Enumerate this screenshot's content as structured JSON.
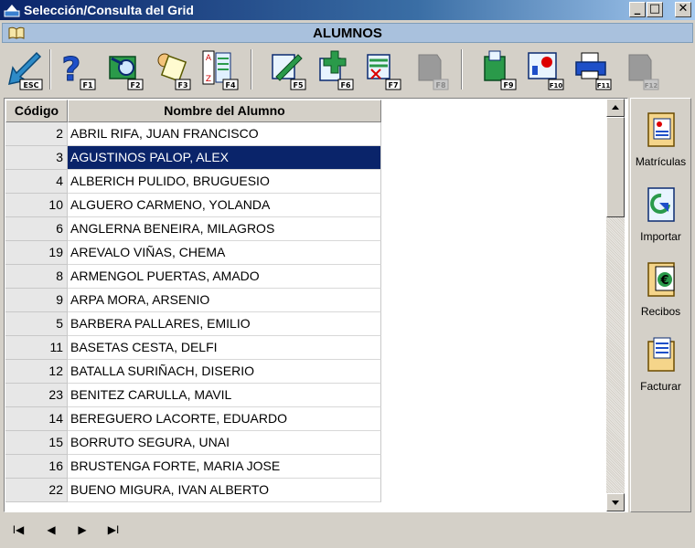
{
  "window": {
    "title": "Selección/Consulta del Grid",
    "min_symbol": "_",
    "max_symbol": "□",
    "close_symbol": "✕"
  },
  "header": {
    "title": "ALUMNOS"
  },
  "toolbar": {
    "keys": [
      "ESC",
      "F1",
      "F2",
      "F3",
      "F4",
      "F5",
      "F6",
      "F7",
      "F8",
      "F9",
      "F10",
      "F11",
      "F12"
    ]
  },
  "grid": {
    "columns": {
      "code": "Código",
      "name": "Nombre del Alumno"
    },
    "rows": [
      {
        "code": "2",
        "name": "ABRIL RIFA, JUAN FRANCISCO"
      },
      {
        "code": "3",
        "name": "AGUSTINOS PALOP, ALEX"
      },
      {
        "code": "4",
        "name": "ALBERICH PULIDO, BRUGUESIO"
      },
      {
        "code": "10",
        "name": "ALGUERO CARMENO, YOLANDA"
      },
      {
        "code": "6",
        "name": "ANGLERNA BENEIRA, MILAGROS"
      },
      {
        "code": "19",
        "name": "AREVALO VIÑAS, CHEMA"
      },
      {
        "code": "8",
        "name": "ARMENGOL PUERTAS, AMADO"
      },
      {
        "code": "9",
        "name": "ARPA MORA, ARSENIO"
      },
      {
        "code": "5",
        "name": "BARBERA PALLARES, EMILIO"
      },
      {
        "code": "11",
        "name": "BASETAS CESTA, DELFI"
      },
      {
        "code": "12",
        "name": "BATALLA SURIÑACH, DISERIO"
      },
      {
        "code": "23",
        "name": "BENITEZ CARULLA, MAVIL"
      },
      {
        "code": "14",
        "name": "BEREGUERO LACORTE, EDUARDO"
      },
      {
        "code": "15",
        "name": "BORRUTO SEGURA, UNAI"
      },
      {
        "code": "16",
        "name": "BRUSTENGA FORTE, MARIA JOSE"
      },
      {
        "code": "22",
        "name": "BUENO MIGURA, IVAN ALBERTO"
      }
    ],
    "selected_code": "3"
  },
  "side_panel": {
    "items": [
      {
        "label": "Matrículas"
      },
      {
        "label": "Importar"
      },
      {
        "label": "Recibos"
      },
      {
        "label": "Facturar"
      }
    ]
  },
  "nav": {
    "first": "I◀",
    "prev": "◀",
    "next": "▶",
    "last": "▶I"
  },
  "colors": {
    "selection": "#0a246a",
    "header_band": "#a9c1dd",
    "face": "#d4d0c8"
  }
}
